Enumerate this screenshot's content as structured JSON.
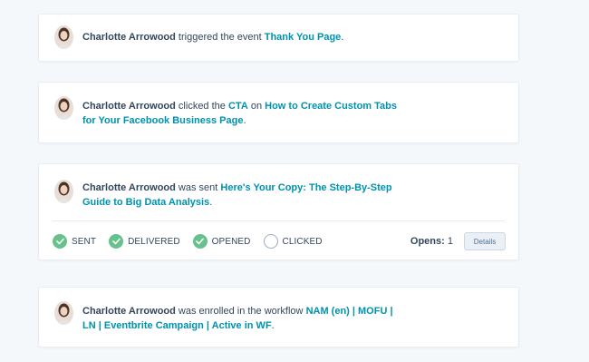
{
  "timeline": [
    {
      "name": "Charlotte Arrowood",
      "pre": " triggered the event ",
      "link1": "Thank You Page",
      "post": "."
    },
    {
      "name": "Charlotte Arrowood",
      "pre": " clicked the ",
      "link1": "CTA",
      "mid": " on ",
      "link2": "How to Create Custom Tabs for Your Facebook Business Page",
      "post": "."
    },
    {
      "name": "Charlotte Arrowood",
      "pre": " was sent ",
      "link1": "Here's Your Copy: The Step-By-Step Guide to Big Data Analysis",
      "post": ".",
      "statuses": [
        {
          "label": "SENT",
          "state": "done"
        },
        {
          "label": "DELIVERED",
          "state": "done"
        },
        {
          "label": "OPENED",
          "state": "done"
        },
        {
          "label": "CLICKED",
          "state": "pending"
        }
      ],
      "opens_label": "Opens:",
      "opens_value": "1",
      "details_label": "Details"
    },
    {
      "name": "Charlotte Arrowood",
      "pre": " was enrolled in the workflow ",
      "link1": "NAM (en) | MOFU | LN | Eventbrite Campaign | Active in WF",
      "post": "."
    }
  ],
  "colors": {
    "link": "#0091ae",
    "text": "#33475b",
    "success": "#66c18c",
    "background": "#f5f8fa"
  }
}
